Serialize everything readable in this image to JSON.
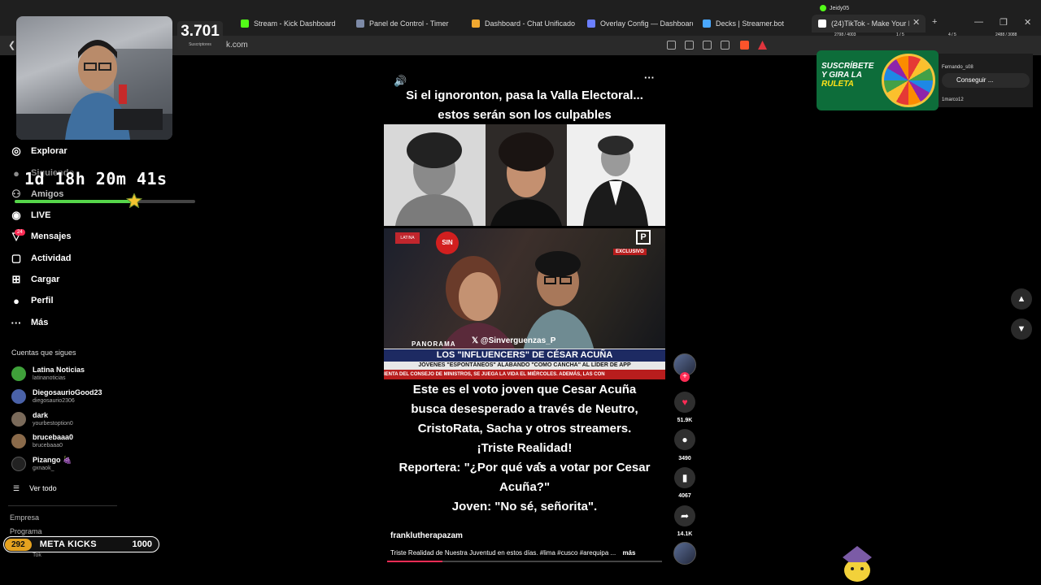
{
  "browser": {
    "tabs": [
      {
        "label": "Stream - Kick Dashboard",
        "color": "#53fc18"
      },
      {
        "label": "Panel de Control - Timer",
        "color": "#7d8aa7"
      },
      {
        "label": "Dashboard - Chat Unificado",
        "color": "#f0a830"
      },
      {
        "label": "Overlay Config — Dashboard",
        "color": "#6b7fff"
      },
      {
        "label": "Decks | Streamer.bot",
        "color": "#4aa8ff"
      },
      {
        "label": "(24)TikTok - Make Your D",
        "color": "#ffffff"
      }
    ],
    "profile": "Jeidy05",
    "url_fragment": "k.com"
  },
  "stream": {
    "subscriber_count": "3.701",
    "subscriber_label": "Suscriptores",
    "timer": "1d 18h 20m 41s",
    "timer_progress": 0.66,
    "meta_kicks": {
      "current": "292",
      "label": "META KICKS",
      "goal": "1000"
    },
    "top_counters": [
      "2798 / 4003",
      "1 / 5",
      "4 / 5",
      "2488 / 3088"
    ]
  },
  "sidebar": {
    "nav": [
      {
        "icon": "compass-icon",
        "glyph": "◎",
        "label": "Explorar"
      },
      {
        "icon": "following-icon",
        "glyph": "●",
        "label": "Siguiendo"
      },
      {
        "icon": "friends-icon",
        "glyph": "⚇",
        "label": "Amigos"
      },
      {
        "icon": "live-icon",
        "glyph": "◉",
        "label": "LIVE"
      },
      {
        "icon": "messages-icon",
        "glyph": "▽",
        "label": "Mensajes"
      },
      {
        "icon": "activity-icon",
        "glyph": "▢",
        "label": "Actividad"
      },
      {
        "icon": "upload-icon",
        "glyph": "⊞",
        "label": "Cargar"
      },
      {
        "icon": "profile-icon",
        "glyph": "●",
        "label": "Perfil"
      },
      {
        "icon": "more-icon",
        "glyph": "···",
        "label": "Más"
      }
    ],
    "messages_badge": "24",
    "following_title": "Cuentas que sigues",
    "accounts": [
      {
        "name": "Latina Noticias",
        "handle": "latinanoticias",
        "color": "#3fa13a"
      },
      {
        "name": "DiegosaurioGood23",
        "handle": "diegosaurio2306",
        "color": "#4a62a8"
      },
      {
        "name": "dark",
        "handle": "yourbestoption0",
        "color": "#7a6a5a"
      },
      {
        "name": "brucebaaa0",
        "handle": "brucebaaa0",
        "color": "#8a6a4a"
      },
      {
        "name": "Pizango 🍇",
        "handle": "gxnaok_",
        "color": "#222222"
      }
    ],
    "see_all": "Ver todo",
    "footer": [
      "Empresa",
      "Programa"
    ],
    "footer_small": "Tok"
  },
  "video": {
    "top_caption_line1": "Si el ignoronton, pasa la Valla Electoral...",
    "top_caption_line2": "estos serán son los culpables",
    "news_logo_left": "LATINA",
    "news_logo_sin": "SIN",
    "news_exclusive": "EXCLUSIVO",
    "news_handle": "𝕏 @Sinverguenzas_P",
    "news_channel": "PANORAMA",
    "news_headline": "LOS \"INFLUENCERS\" DE CÉSAR ACUÑA",
    "news_subheadline": "JÓVENES \"ESPONTÁNEOS\" ALABANDO \"COMO CANCHA\" AL LÍDER DE APP",
    "news_ticker": "IENTA DEL CONSEJO DE MINISTROS, SE JUEGA LA VIDA EL MIÉRCOLES. ADEMÁS, LAS CON",
    "body_lines": [
      "Este es el voto joven que Cesar Acuña",
      "busca desesperado a través de Neutro,",
      "CristoRata, Sacha y otros streamers.",
      "¡Triste Realidad!",
      "Reportera: \"¿Por qué vas a votar por Cesar",
      "Acuña?\"",
      "Joven: \"No sé, señorita\"."
    ],
    "author": "franklutherapazam",
    "description": "Triste Realidad de Nuestra Juventud en estos días. #lima #cusco #arequipa ...",
    "more": "más",
    "progress": 0.2
  },
  "actions": {
    "likes": "51.9K",
    "comments": "3490",
    "saves": "4067",
    "shares": "14.1K"
  },
  "overlay": {
    "roulette_line1": "SUSCRÍBETE",
    "roulette_line2": "Y GIRA LA",
    "roulette_line3": "RULETA",
    "chat_user": "Fernando_s08",
    "chat_button": "Conseguir ...",
    "chat_user2": "1marco12"
  }
}
